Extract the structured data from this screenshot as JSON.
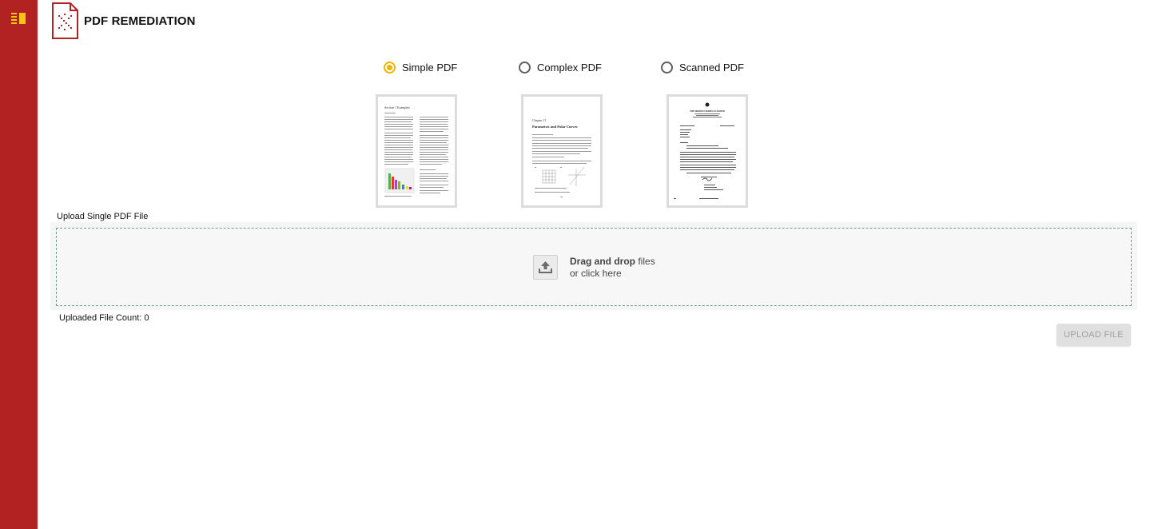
{
  "app": {
    "title": "PDF REMEDIATION"
  },
  "sidebar": {
    "menu_icon": "menu-list-icon",
    "color": "#b22222"
  },
  "pdf_type": {
    "options": [
      {
        "label": "Simple PDF",
        "checked": true
      },
      {
        "label": "Complex PDF",
        "checked": false
      },
      {
        "label": "Scanned PDF",
        "checked": false
      }
    ]
  },
  "thumbnails": {
    "simple": {
      "heading": "Section 1 Examples"
    },
    "complex": {
      "chapter": "Chapter 11",
      "heading": "Parametric and Polar Curves"
    },
    "scanned": {
      "company": "THE MIDWEST HOMECO LIMITED"
    }
  },
  "upload": {
    "label": "Upload Single PDF File",
    "drop_bold": "Drag and drop",
    "drop_rest": " files",
    "drop_line2": "or click here",
    "file_count": "Uploaded File Count: 0",
    "button": "UPLOAD FILE"
  },
  "colors": {
    "accent": "#f0b400",
    "brand": "#b22222"
  }
}
